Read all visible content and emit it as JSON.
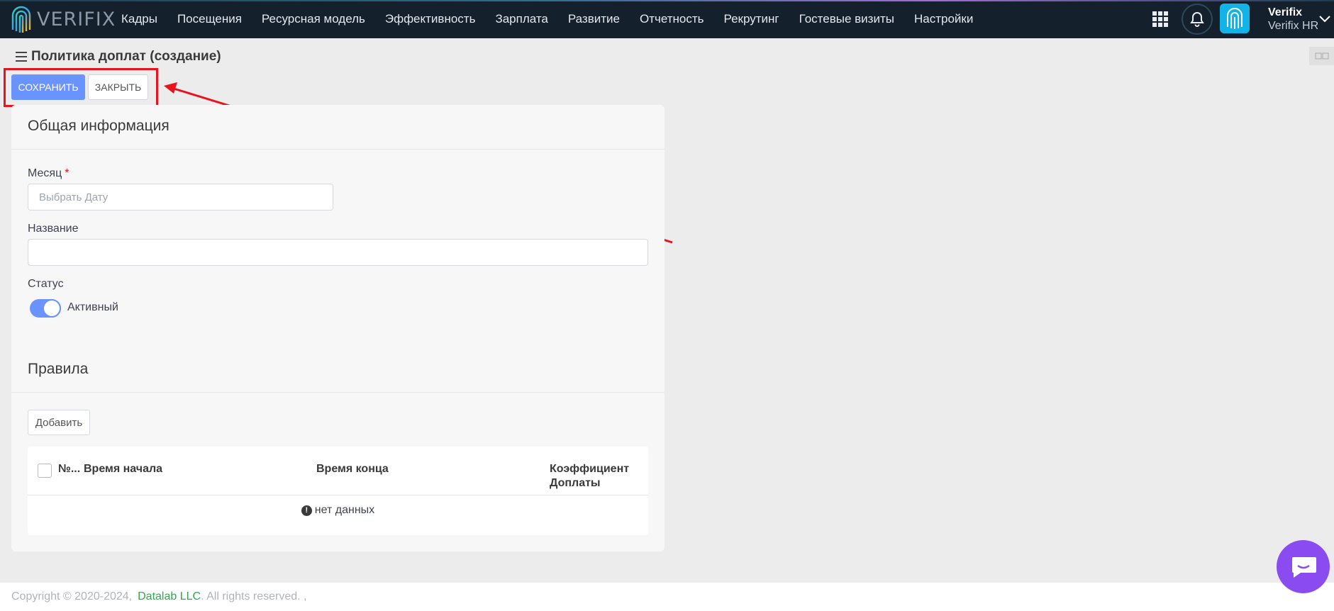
{
  "brand": {
    "logo_text": "VERIFIX"
  },
  "nav": {
    "items": [
      {
        "label": "Кадры"
      },
      {
        "label": "Посещения"
      },
      {
        "label": "Ресурсная модель"
      },
      {
        "label": "Эффективность"
      },
      {
        "label": "Зарплата"
      },
      {
        "label": "Развитие"
      },
      {
        "label": "Отчетность"
      },
      {
        "label": "Рекрутинг"
      },
      {
        "label": "Гостевые визиты"
      },
      {
        "label": "Настройки"
      }
    ]
  },
  "user": {
    "name": "Verifix",
    "org": "Verifix HR"
  },
  "page": {
    "title": "Политика доплат (создание)",
    "save_label": "СОХРАНИТЬ",
    "close_label": "ЗАКРЫТЬ"
  },
  "general": {
    "title": "Общая информация",
    "month_label": "Месяц",
    "month_required_mark": "*",
    "month_placeholder": "Выбрать Дату",
    "name_label": "Название",
    "name_value": "",
    "status_label": "Статус",
    "status_value": "Активный"
  },
  "rules": {
    "title": "Правила",
    "add_label": "Добавить",
    "columns": {
      "number": "№...",
      "start": "Время начала",
      "end": "Время конца",
      "coef_line1": "Коэффициент",
      "coef_line2": "Доплаты"
    },
    "empty_text": "нет данных"
  },
  "footer": {
    "copyright": "Copyright © 2020-2024,",
    "company": "Datalab LLC",
    "rights": ". All rights reserved. ,"
  },
  "colors": {
    "accent": "#6993ff",
    "topbar": "#14202b",
    "highlight": "#e8141d",
    "chat": "#8a4cf0",
    "footer_link": "#2fa84f"
  }
}
